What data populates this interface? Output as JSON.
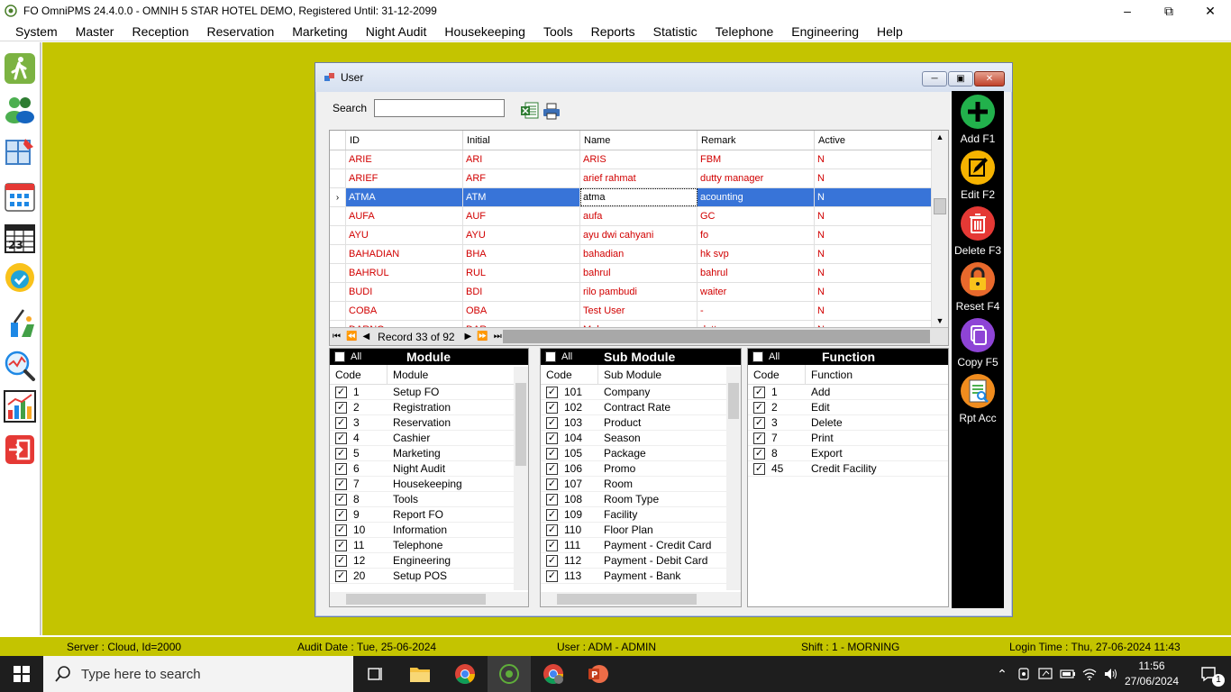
{
  "window": {
    "title": "FO OmniPMS 24.4.0.0 - OMNIH 5 STAR HOTEL DEMO, Registered Until: 31-12-2099",
    "minimize": "–",
    "maximize": "⧉",
    "close": "✕"
  },
  "menu": [
    "System",
    "Master",
    "Reception",
    "Reservation",
    "Marketing",
    "Night Audit",
    "Housekeeping",
    "Tools",
    "Reports",
    "Statistic",
    "Telephone",
    "Engineering",
    "Help"
  ],
  "child": {
    "title": "User",
    "search_label": "Search",
    "search_value": ""
  },
  "grid": {
    "columns": [
      "ID",
      "Initial",
      "Name",
      "Remark",
      "Active"
    ],
    "rows": [
      [
        "ARIE",
        "ARI",
        "ARIS",
        "FBM",
        "N"
      ],
      [
        "ARIEF",
        "ARF",
        "arief rahmat",
        "dutty manager",
        "N"
      ],
      [
        "ATMA",
        "ATM",
        "atma",
        "acounting",
        "N"
      ],
      [
        "AUFA",
        "AUF",
        "aufa",
        "GC",
        "N"
      ],
      [
        "AYU",
        "AYU",
        "ayu dwi cahyani",
        "fo",
        "N"
      ],
      [
        "BAHADIAN",
        "BHA",
        "bahadian",
        "hk svp",
        "N"
      ],
      [
        "BAHRUL",
        "RUL",
        "bahrul",
        "bahrul",
        "N"
      ],
      [
        "BUDI",
        "BDI",
        "rilo pambudi",
        "waiter",
        "N"
      ],
      [
        "COBA",
        "OBA",
        "Test User",
        "-",
        "N"
      ],
      [
        "DARNO",
        "DAR",
        "Mulyo",
        "dutty",
        "N"
      ]
    ],
    "selected_row": 2,
    "record_text": "Record 33 of 92"
  },
  "module_panel": {
    "all_label": "All",
    "title": "Module",
    "col_code": "Code",
    "col_desc": "Module",
    "items": [
      [
        "1",
        "Setup FO"
      ],
      [
        "2",
        "Registration"
      ],
      [
        "3",
        "Reservation"
      ],
      [
        "4",
        "Cashier"
      ],
      [
        "5",
        "Marketing"
      ],
      [
        "6",
        "Night Audit"
      ],
      [
        "7",
        "Housekeeping"
      ],
      [
        "8",
        "Tools"
      ],
      [
        "9",
        "Report FO"
      ],
      [
        "10",
        "Information"
      ],
      [
        "11",
        "Telephone"
      ],
      [
        "12",
        "Engineering"
      ],
      [
        "20",
        "Setup POS"
      ]
    ]
  },
  "submodule_panel": {
    "all_label": "All",
    "title": "Sub Module",
    "col_code": "Code",
    "col_desc": "Sub Module",
    "items": [
      [
        "101",
        "Company"
      ],
      [
        "102",
        "Contract Rate"
      ],
      [
        "103",
        "Product"
      ],
      [
        "104",
        "Season"
      ],
      [
        "105",
        "Package"
      ],
      [
        "106",
        "Promo"
      ],
      [
        "107",
        "Room"
      ],
      [
        "108",
        "Room Type"
      ],
      [
        "109",
        "Facility"
      ],
      [
        "110",
        "Floor Plan"
      ],
      [
        "111",
        "Payment - Credit Card"
      ],
      [
        "112",
        "Payment - Debit Card"
      ],
      [
        "113",
        "Payment - Bank"
      ]
    ]
  },
  "function_panel": {
    "all_label": "All",
    "title": "Function",
    "col_code": "Code",
    "col_desc": "Function",
    "items": [
      [
        "1",
        "Add"
      ],
      [
        "2",
        "Edit"
      ],
      [
        "3",
        "Delete"
      ],
      [
        "7",
        "Print"
      ],
      [
        "8",
        "Export"
      ],
      [
        "45",
        "Credit Facility"
      ]
    ]
  },
  "actions": [
    {
      "label": "Add F1",
      "icon": "add-icon",
      "color": "#22b14c"
    },
    {
      "label": "Edit F2",
      "icon": "edit-icon",
      "color": "#f5b300"
    },
    {
      "label": "Delete F3",
      "icon": "trash-icon",
      "color": "#e53935"
    },
    {
      "label": "Reset F4",
      "icon": "lock-icon",
      "color": "#e8692c"
    },
    {
      "label": "Copy F5",
      "icon": "copy-icon",
      "color": "#8e44d6"
    },
    {
      "label": "Rpt Acc",
      "icon": "report-icon",
      "color": "#f08c1e"
    }
  ],
  "status": {
    "server": "Server : Cloud, Id=2000",
    "audit": "Audit Date : Tue, 25-06-2024",
    "user": "User : ADM - ADMIN",
    "shift": "Shift : 1 - MORNING",
    "login": "Login Time : Thu, 27-06-2024 11:43"
  },
  "taskbar": {
    "search_placeholder": "Type here to search",
    "time": "11:56",
    "date": "27/06/2024",
    "notification_count": "1"
  },
  "colors": {
    "desktop": "#c4c400",
    "selected_row": "#3874d8",
    "grid_text": "#d10000"
  }
}
